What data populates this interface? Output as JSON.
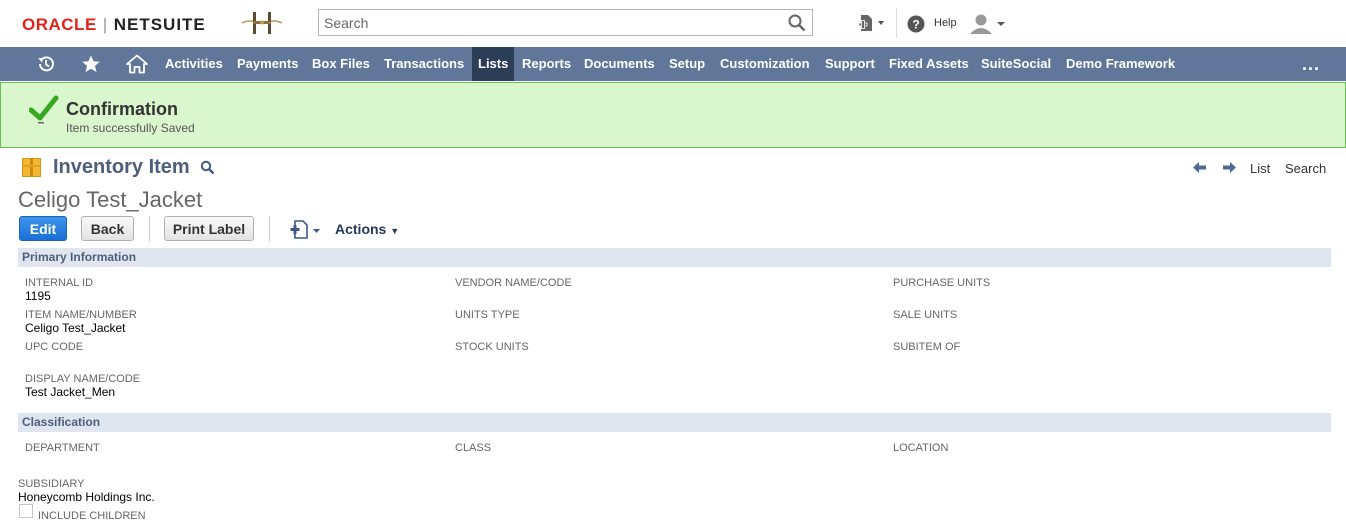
{
  "header": {
    "brand_oracle": "ORACLE",
    "brand_separator": "|",
    "brand_netsuite": "NETSUITE",
    "search_placeholder": "Search",
    "help_label": "Help"
  },
  "nav": {
    "items": [
      {
        "label": "Activities"
      },
      {
        "label": "Payments"
      },
      {
        "label": "Box Files"
      },
      {
        "label": "Transactions"
      },
      {
        "label": "Lists"
      },
      {
        "label": "Reports"
      },
      {
        "label": "Documents"
      },
      {
        "label": "Setup"
      },
      {
        "label": "Customization"
      },
      {
        "label": "Support"
      },
      {
        "label": "Fixed Assets"
      },
      {
        "label": "SuiteSocial"
      },
      {
        "label": "Demo Framework"
      }
    ],
    "active": "Lists",
    "more": "..."
  },
  "confirmation": {
    "title": "Confirmation",
    "message": "Item successfully Saved"
  },
  "record": {
    "type": "Inventory Item",
    "name": "Celigo Test_Jacket",
    "pager_list": "List",
    "pager_search": "Search"
  },
  "buttons": {
    "edit": "Edit",
    "back": "Back",
    "print_label": "Print Label",
    "actions": "Actions"
  },
  "primary": {
    "title": "Primary Information",
    "internal_id_label": "INTERNAL ID",
    "internal_id_value": "1195",
    "item_name_label": "ITEM NAME/NUMBER",
    "item_name_value": "Celigo Test_Jacket",
    "upc_label": "UPC CODE",
    "display_name_label": "DISPLAY NAME/CODE",
    "display_name_value": "Test Jacket_Men",
    "vendor_label": "VENDOR NAME/CODE",
    "units_type_label": "UNITS TYPE",
    "stock_units_label": "STOCK UNITS",
    "purchase_units_label": "PURCHASE UNITS",
    "sale_units_label": "SALE UNITS",
    "subitem_label": "SUBITEM OF"
  },
  "classification": {
    "title": "Classification",
    "department_label": "DEPARTMENT",
    "class_label": "CLASS",
    "location_label": "LOCATION",
    "subsidiary_label": "SUBSIDIARY",
    "subsidiary_value": "Honeycomb Holdings Inc.",
    "include_children_label": "INCLUDE CHILDREN",
    "include_children_checked": false
  },
  "colors": {
    "navbar": "#607799",
    "nav_active": "#2b3d57",
    "confirm_bg": "#daf6cd",
    "confirm_border": "#6bbc54",
    "primary_button": "#2a7ee2",
    "section_header": "#e0e6ef",
    "oracle_red": "#e2231a"
  },
  "icons": {
    "recent": "recent-records-icon",
    "favorites": "star-icon",
    "home": "home-icon",
    "search": "search-icon",
    "create": "create-new-icon",
    "help": "help-icon",
    "user": "user-icon",
    "success": "checkmark-icon",
    "record_type": "inventory-box-icon",
    "prev": "arrow-left-icon",
    "next": "arrow-right-icon",
    "new_record": "new-record-icon"
  }
}
